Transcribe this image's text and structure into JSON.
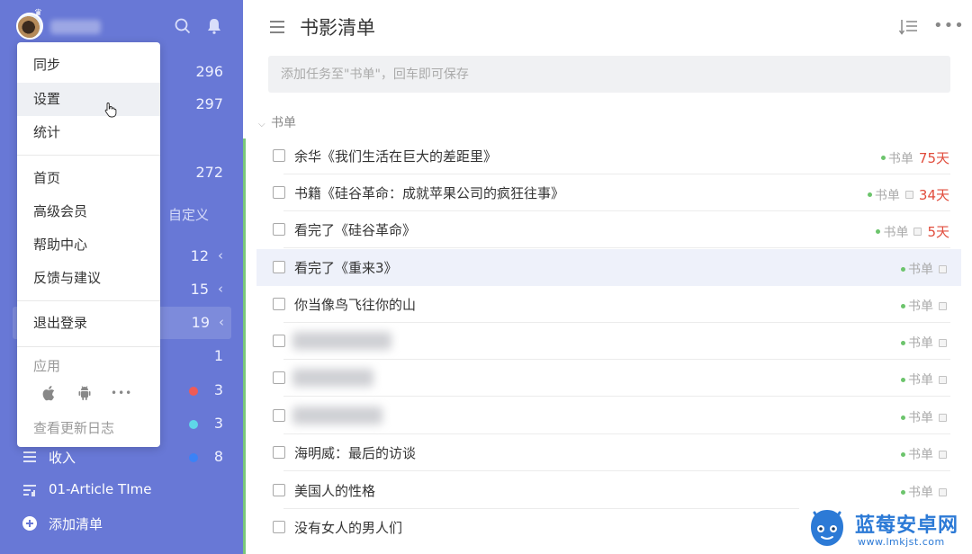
{
  "sidebar": {
    "counts_top": [
      "296",
      "297",
      "272"
    ],
    "custom_label": "自定义",
    "rows": [
      {
        "count": "12",
        "arrow": "‹"
      },
      {
        "count": "15",
        "arrow": "‹"
      },
      {
        "count": "19",
        "arrow": "‹"
      },
      {
        "count": "1"
      },
      {
        "count": "3",
        "dot_color": "#ef5b57"
      },
      {
        "count": "3",
        "dot_color": "#5fd6e8"
      },
      {
        "label": "收入",
        "count": "8",
        "dot_color": "#3b82f6"
      },
      {
        "label": "01-Article TIme"
      },
      {
        "label": "添加清单"
      }
    ]
  },
  "menu": {
    "items_group1": [
      "同步",
      "设置",
      "统计"
    ],
    "items_group2": [
      "首页",
      "高级会员",
      "帮助中心",
      "反馈与建议"
    ],
    "logout": "退出登录",
    "apps_label": "应用",
    "apps_more": "•••",
    "changelog": "查看更新日志"
  },
  "main": {
    "title": "书影清单",
    "add_placeholder": "添加任务至\"书单\"，回车即可保存",
    "more": "•••",
    "section": "书单",
    "tasks": [
      {
        "name": "余华《我们生活在巨大的差距里》",
        "tag": "书单",
        "due": "75天"
      },
      {
        "name": "书籍《硅谷革命：成就苹果公司的疯狂往事》",
        "tag": "书单",
        "due": "34天"
      },
      {
        "name": "看完了《硅谷革命》",
        "tag": "书单",
        "due": "5天"
      },
      {
        "name": "看完了《重来3》",
        "tag": "书单"
      },
      {
        "name": "你当像鸟飞往你的山",
        "tag": "书单"
      },
      {
        "name": "",
        "tag": "书单"
      },
      {
        "name": "",
        "tag": "书单"
      },
      {
        "name": "",
        "tag": "书单"
      },
      {
        "name": "海明威：最后的访谈",
        "tag": "书单"
      },
      {
        "name": "美国人的性格",
        "tag": "书单"
      },
      {
        "name": "没有女人的男人们",
        "tag": "书单"
      }
    ]
  },
  "watermark": {
    "title": "蓝莓安卓网",
    "url": "www.lmkjst.com"
  }
}
